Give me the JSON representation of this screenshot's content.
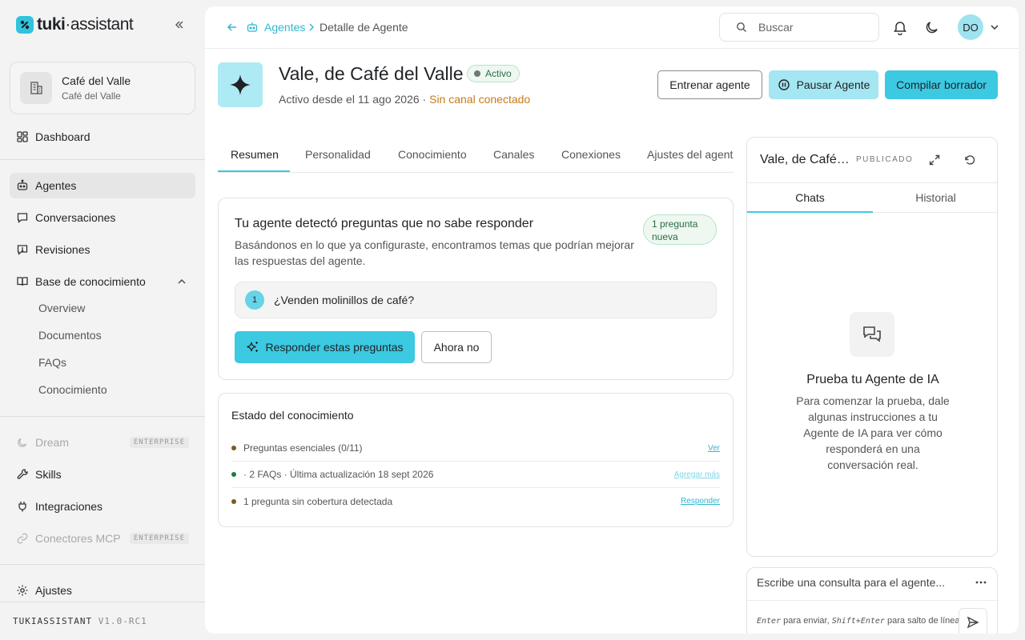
{
  "brand": {
    "name_bold": "tuki",
    "name_dot": "·",
    "name_rest": "assistant"
  },
  "org": {
    "name": "Café del Valle",
    "sub": "Café del Valle"
  },
  "sidebar": {
    "dashboard": "Dashboard",
    "agentes": "Agentes",
    "conversaciones": "Conversaciones",
    "revisiones": "Revisiones",
    "base": "Base de conocimiento",
    "base_items": [
      "Overview",
      "Documentos",
      "FAQs",
      "Conocimiento"
    ],
    "dream": "Dream",
    "skills": "Skills",
    "integraciones": "Integraciones",
    "conectores": "Conectores MCP",
    "enterprise": "ENTERPRISE",
    "ajustes": "Ajustes"
  },
  "version": {
    "name": "TUKIASSISTANT",
    "ver": "V1.0-RC1"
  },
  "topbar": {
    "crumb_link": "Agentes",
    "crumb_current": "Detalle de Agente",
    "search_placeholder": "Buscar",
    "avatar_initials": "DO"
  },
  "agent": {
    "name": "Vale, de Café del Valle",
    "status": "Activo",
    "since": "Activo desde el 11 ago 2026",
    "dot_sep": " · ",
    "channel_warning": "Sin canal conectado"
  },
  "actions": {
    "train": "Entrenar agente",
    "pause": "Pausar Agente",
    "compile": "Compilar borrador"
  },
  "tabs": [
    "Resumen",
    "Personalidad",
    "Conocimiento",
    "Canales",
    "Conexiones",
    "Ajustes del agente"
  ],
  "questions_card": {
    "title": "Tu agente detectó preguntas que no sabe responder",
    "desc": "Basándonos en lo que ya configuraste, encontramos temas que podrían mejorar las respuestas del agente.",
    "badge": "1 pregunta nueva",
    "items": [
      {
        "num": "1",
        "text": "¿Venden molinillos de café?"
      }
    ],
    "answer_btn": "Responder estas preguntas",
    "later_btn": "Ahora no"
  },
  "knowledge_card": {
    "title": "Estado del conocimiento",
    "rows": [
      {
        "text": "Preguntas esenciales (0/11)",
        "link": "Ver",
        "dot": "#7a5a1e",
        "link_color": "#2fb7cf"
      },
      {
        "text": "· 2 FAQs · Última actualización 18 sept 2026",
        "link": "Agregar más",
        "dot": "#1f7a3a",
        "link_color": "#7fd6e6"
      },
      {
        "text": "1 pregunta sin cobertura detectada",
        "link": "Responder",
        "dot": "#7a5a1e",
        "link_color": "#2fb7cf"
      }
    ]
  },
  "preview": {
    "title": "Vale, de Café del Valle",
    "published": "PUBLICADO",
    "tabs": [
      "Chats",
      "Historial"
    ],
    "empty_title": "Prueba tu Agente de IA",
    "empty_desc": "Para comenzar la prueba, dale algunas instrucciones a tu Agente de IA para ver cómo responderá en una conversación real.",
    "composer_placeholder": "Escribe una consulta para el agente...",
    "hint_enter": "Enter",
    "hint_a": " para enviar, ",
    "hint_shift": "Shift+Enter",
    "hint_b": " para salto de línea"
  },
  "colors": {
    "accent": "#3cc9e2",
    "accent_light": "#a4e6f1",
    "warning": "#c77a1a",
    "success_bg": "#eef8f1"
  }
}
